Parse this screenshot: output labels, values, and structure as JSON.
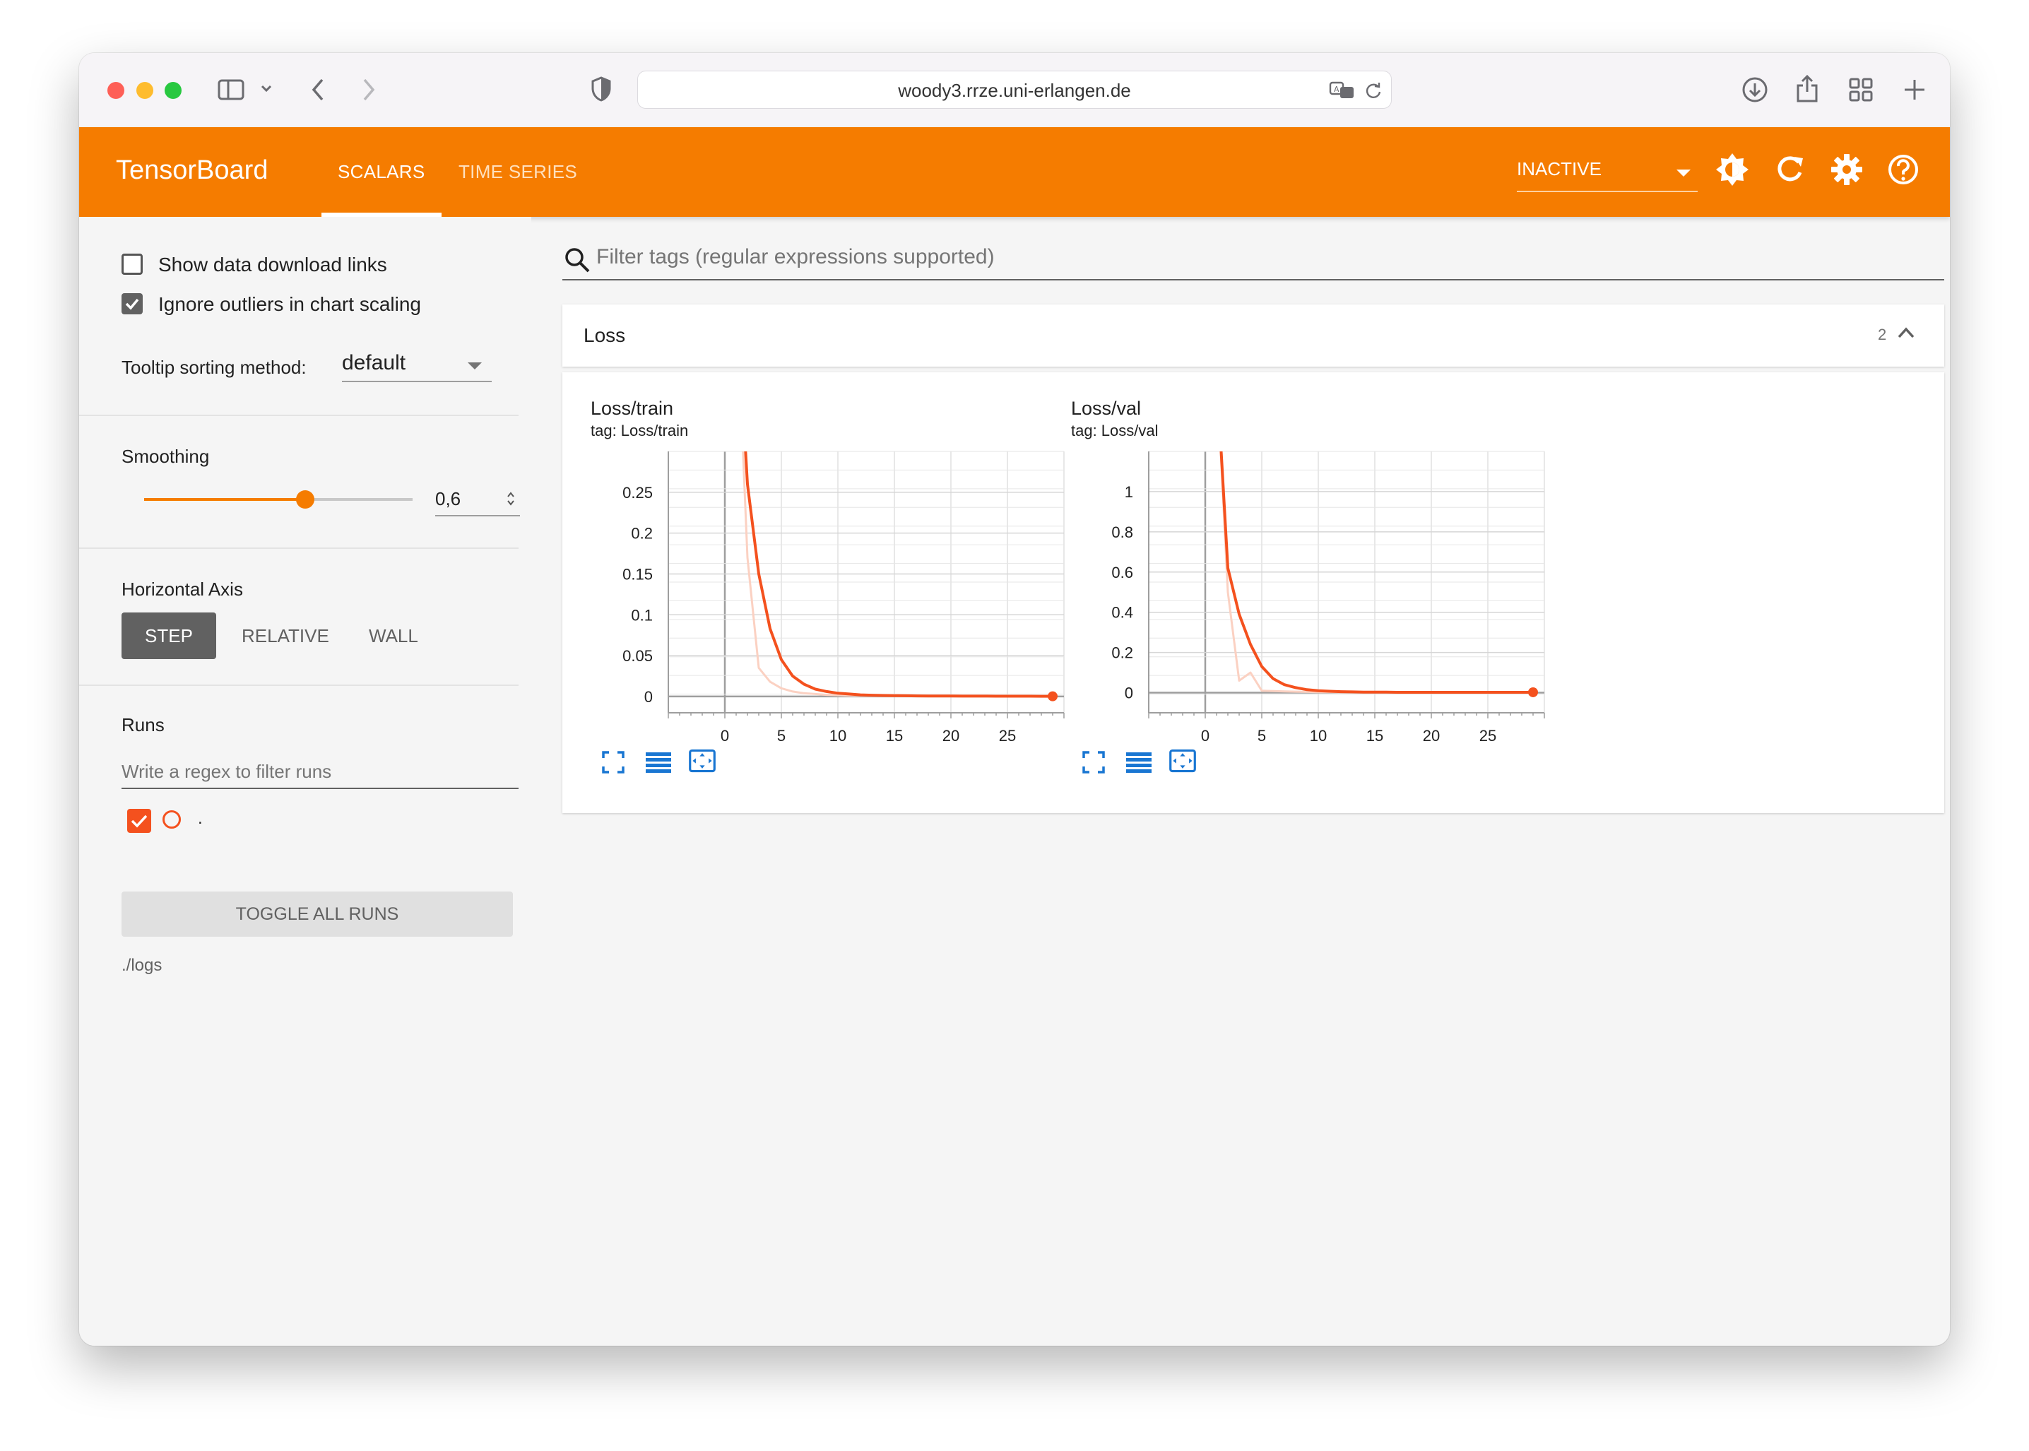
{
  "browser": {
    "url": "woody3.rrze.uni-erlangen.de"
  },
  "header": {
    "brand": "TensorBoard",
    "tabs": [
      "SCALARS",
      "TIME SERIES"
    ],
    "status_select": "INACTIVE"
  },
  "sidebar": {
    "show_download_links": "Show data download links",
    "ignore_outliers": "Ignore outliers in chart scaling",
    "tooltip_label": "Tooltip sorting method:",
    "tooltip_value": "default",
    "smoothing_label": "Smoothing",
    "smoothing_value": "0,6",
    "smoothing_level": 0.6,
    "horizontal_axis_label": "Horizontal Axis",
    "axis_buttons": [
      "STEP",
      "RELATIVE",
      "WALL"
    ],
    "runs_label": "Runs",
    "runs_filter_placeholder": "Write a regex to filter runs",
    "run_name": ".",
    "toggle_all_runs": "TOGGLE ALL RUNS",
    "logdir": "./logs"
  },
  "main": {
    "filter_placeholder": "Filter tags (regular expressions supported)",
    "group_title": "Loss",
    "group_count": "2"
  },
  "colors": {
    "accent": "#f57c00",
    "run": "#f4511e"
  },
  "chart_data": [
    {
      "type": "line",
      "title": "Loss/train",
      "subtitle": "tag: Loss/train",
      "xlim": [
        -5,
        30
      ],
      "ylim": [
        -0.02,
        0.3
      ],
      "x_ticks": [
        0,
        5,
        10,
        15,
        20,
        25
      ],
      "y_ticks": [
        0,
        0.05,
        0.1,
        0.15,
        0.2,
        0.25
      ],
      "y_tick_labels": [
        "0",
        "0.05",
        "0.1",
        "0.15",
        "0.2",
        "0.25"
      ],
      "series": [
        {
          "kind": "raw",
          "x": [
            1,
            2,
            3,
            4,
            5,
            6,
            7,
            8,
            9,
            10,
            11,
            12,
            13,
            14,
            15,
            16,
            17,
            18,
            19,
            20,
            21,
            22,
            23,
            24,
            25,
            26,
            27,
            28,
            29
          ],
          "values": [
            0.5,
            0.17,
            0.035,
            0.018,
            0.01,
            0.006,
            0.004,
            0.003,
            0.002,
            0.0015,
            0.001,
            0.001,
            0.0008,
            0.0007,
            0.0006,
            0.0005,
            0.0005,
            0.0004,
            0.0004,
            0.0004,
            0.0003,
            0.0003,
            0.0003,
            0.0003,
            0.0002,
            0.0002,
            0.0002,
            0.0002,
            0.0002
          ]
        },
        {
          "kind": "smoothed",
          "x": [
            1,
            2,
            3,
            4,
            5,
            6,
            7,
            8,
            9,
            10,
            11,
            12,
            13,
            14,
            15,
            16,
            17,
            18,
            19,
            20,
            21,
            22,
            23,
            24,
            25,
            26,
            27,
            28,
            29
          ],
          "values": [
            0.5,
            0.26,
            0.15,
            0.083,
            0.045,
            0.025,
            0.015,
            0.009,
            0.006,
            0.004,
            0.003,
            0.002,
            0.0015,
            0.0012,
            0.001,
            0.0008,
            0.0007,
            0.0006,
            0.0005,
            0.0005,
            0.0004,
            0.0004,
            0.0004,
            0.0003,
            0.0003,
            0.0003,
            0.0003,
            0.0002,
            0.0002
          ]
        }
      ]
    },
    {
      "type": "line",
      "title": "Loss/val",
      "subtitle": "tag: Loss/val",
      "xlim": [
        -5,
        30
      ],
      "ylim": [
        -0.1,
        1.2
      ],
      "x_ticks": [
        0,
        5,
        10,
        15,
        20,
        25
      ],
      "y_ticks": [
        0,
        0.2,
        0.4,
        0.6,
        0.8,
        1
      ],
      "y_tick_labels": [
        "0",
        "0.2",
        "0.4",
        "0.6",
        "0.8",
        "1"
      ],
      "series": [
        {
          "kind": "raw",
          "x": [
            1,
            2,
            3,
            4,
            5,
            6,
            7,
            8,
            9,
            10,
            11,
            12,
            13,
            14,
            15,
            16,
            17,
            18,
            19,
            20,
            21,
            22,
            23,
            24,
            25,
            26,
            27,
            28,
            29
          ],
          "values": [
            1.6,
            0.5,
            0.06,
            0.1,
            0.01,
            0.008,
            0.006,
            0.005,
            0.004,
            0.003,
            0.003,
            0.002,
            0.002,
            0.002,
            0.002,
            0.002,
            0.002,
            0.002,
            0.002,
            0.002,
            0.002,
            0.002,
            0.002,
            0.002,
            0.002,
            0.002,
            0.002,
            0.002,
            0.002
          ]
        },
        {
          "kind": "smoothed",
          "x": [
            1,
            2,
            3,
            4,
            5,
            6,
            7,
            8,
            9,
            10,
            11,
            12,
            13,
            14,
            15,
            16,
            17,
            18,
            19,
            20,
            21,
            22,
            23,
            24,
            25,
            26,
            27,
            28,
            29
          ],
          "values": [
            1.6,
            0.62,
            0.39,
            0.24,
            0.13,
            0.07,
            0.04,
            0.025,
            0.015,
            0.01,
            0.007,
            0.005,
            0.004,
            0.003,
            0.003,
            0.003,
            0.002,
            0.002,
            0.002,
            0.002,
            0.002,
            0.002,
            0.002,
            0.002,
            0.002,
            0.002,
            0.002,
            0.002,
            0.002
          ]
        }
      ]
    }
  ]
}
